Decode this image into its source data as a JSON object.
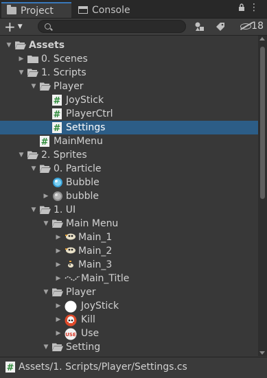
{
  "tabs": [
    {
      "label": "Project",
      "icon": "folder-icon"
    },
    {
      "label": "Console",
      "icon": "console-icon"
    }
  ],
  "toolbar": {
    "add_label": "+",
    "search_placeholder": "",
    "hidden_count": "18"
  },
  "tree": [
    {
      "label": "Assets",
      "depth": 0,
      "arrow": "expanded",
      "icon": "folder-open",
      "bold": true
    },
    {
      "label": "0. Scenes",
      "depth": 1,
      "arrow": "collapsed",
      "icon": "folder"
    },
    {
      "label": "1. Scripts",
      "depth": 1,
      "arrow": "expanded",
      "icon": "folder-open"
    },
    {
      "label": "Player",
      "depth": 2,
      "arrow": "expanded",
      "icon": "folder-open"
    },
    {
      "label": "JoyStick",
      "depth": 3,
      "arrow": "none",
      "icon": "script"
    },
    {
      "label": "PlayerCtrl",
      "depth": 3,
      "arrow": "none",
      "icon": "script"
    },
    {
      "label": "Settings",
      "depth": 3,
      "arrow": "none",
      "icon": "script",
      "selected": true
    },
    {
      "label": "MainMenu",
      "depth": 2,
      "arrow": "none",
      "icon": "script"
    },
    {
      "label": "2. Sprites",
      "depth": 1,
      "arrow": "expanded",
      "icon": "folder-open"
    },
    {
      "label": "0. Particle",
      "depth": 2,
      "arrow": "expanded",
      "icon": "folder-open"
    },
    {
      "label": "Bubble",
      "depth": 3,
      "arrow": "none",
      "icon": "bubble-sprite"
    },
    {
      "label": "bubble",
      "depth": 3,
      "arrow": "collapsed",
      "icon": "bubble-gray-sprite"
    },
    {
      "label": "1. UI",
      "depth": 2,
      "arrow": "expanded",
      "icon": "folder-open"
    },
    {
      "label": "Main Menu",
      "depth": 3,
      "arrow": "expanded",
      "icon": "folder-open"
    },
    {
      "label": "Main_1",
      "depth": 4,
      "arrow": "collapsed",
      "icon": "sprite-a"
    },
    {
      "label": "Main_2",
      "depth": 4,
      "arrow": "collapsed",
      "icon": "sprite-a"
    },
    {
      "label": "Main_3",
      "depth": 4,
      "arrow": "collapsed",
      "icon": "sprite-b"
    },
    {
      "label": "Main_Title",
      "depth": 4,
      "arrow": "collapsed",
      "icon": "sprite-c"
    },
    {
      "label": "Player",
      "depth": 3,
      "arrow": "expanded",
      "icon": "folder-open"
    },
    {
      "label": "JoyStick",
      "depth": 4,
      "arrow": "collapsed",
      "icon": "white-circle-sprite"
    },
    {
      "label": "Kill",
      "depth": 4,
      "arrow": "collapsed",
      "icon": "skull-sprite"
    },
    {
      "label": "Use",
      "depth": 4,
      "arrow": "collapsed",
      "icon": "use-sprite"
    },
    {
      "label": "Setting",
      "depth": 3,
      "arrow": "expanded",
      "icon": "folder-open"
    }
  ],
  "status": {
    "path": "Assets/1. Scripts/Player/Settings.cs"
  },
  "colors": {
    "selection": "#2c5d87",
    "script_icon_bg": "#2e8b3a",
    "background": "#383838"
  }
}
